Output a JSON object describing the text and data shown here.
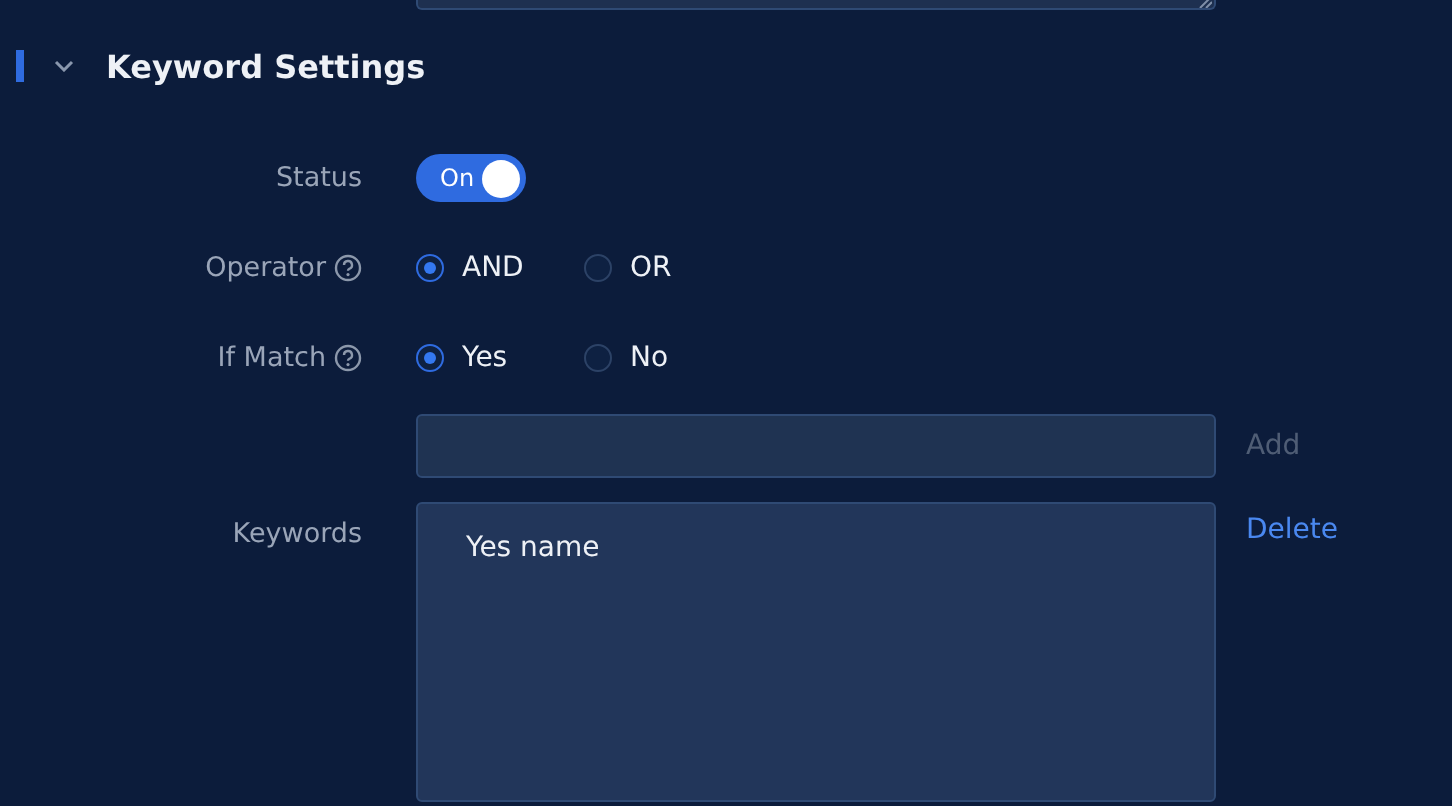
{
  "section": {
    "title": "Keyword Settings",
    "expanded": true
  },
  "status": {
    "label": "Status",
    "on": true,
    "text": "On"
  },
  "operator": {
    "label": "Operator",
    "options": [
      {
        "label": "AND",
        "selected": true
      },
      {
        "label": "OR",
        "selected": false
      }
    ]
  },
  "if_match": {
    "label": "If Match",
    "options": [
      {
        "label": "Yes",
        "selected": true
      },
      {
        "label": "No",
        "selected": false
      }
    ]
  },
  "keyword_input": {
    "add_label": "Add",
    "add_disabled": true
  },
  "keywords": {
    "label": "Keywords",
    "items": [
      "Yes name"
    ],
    "delete_label": "Delete"
  }
}
